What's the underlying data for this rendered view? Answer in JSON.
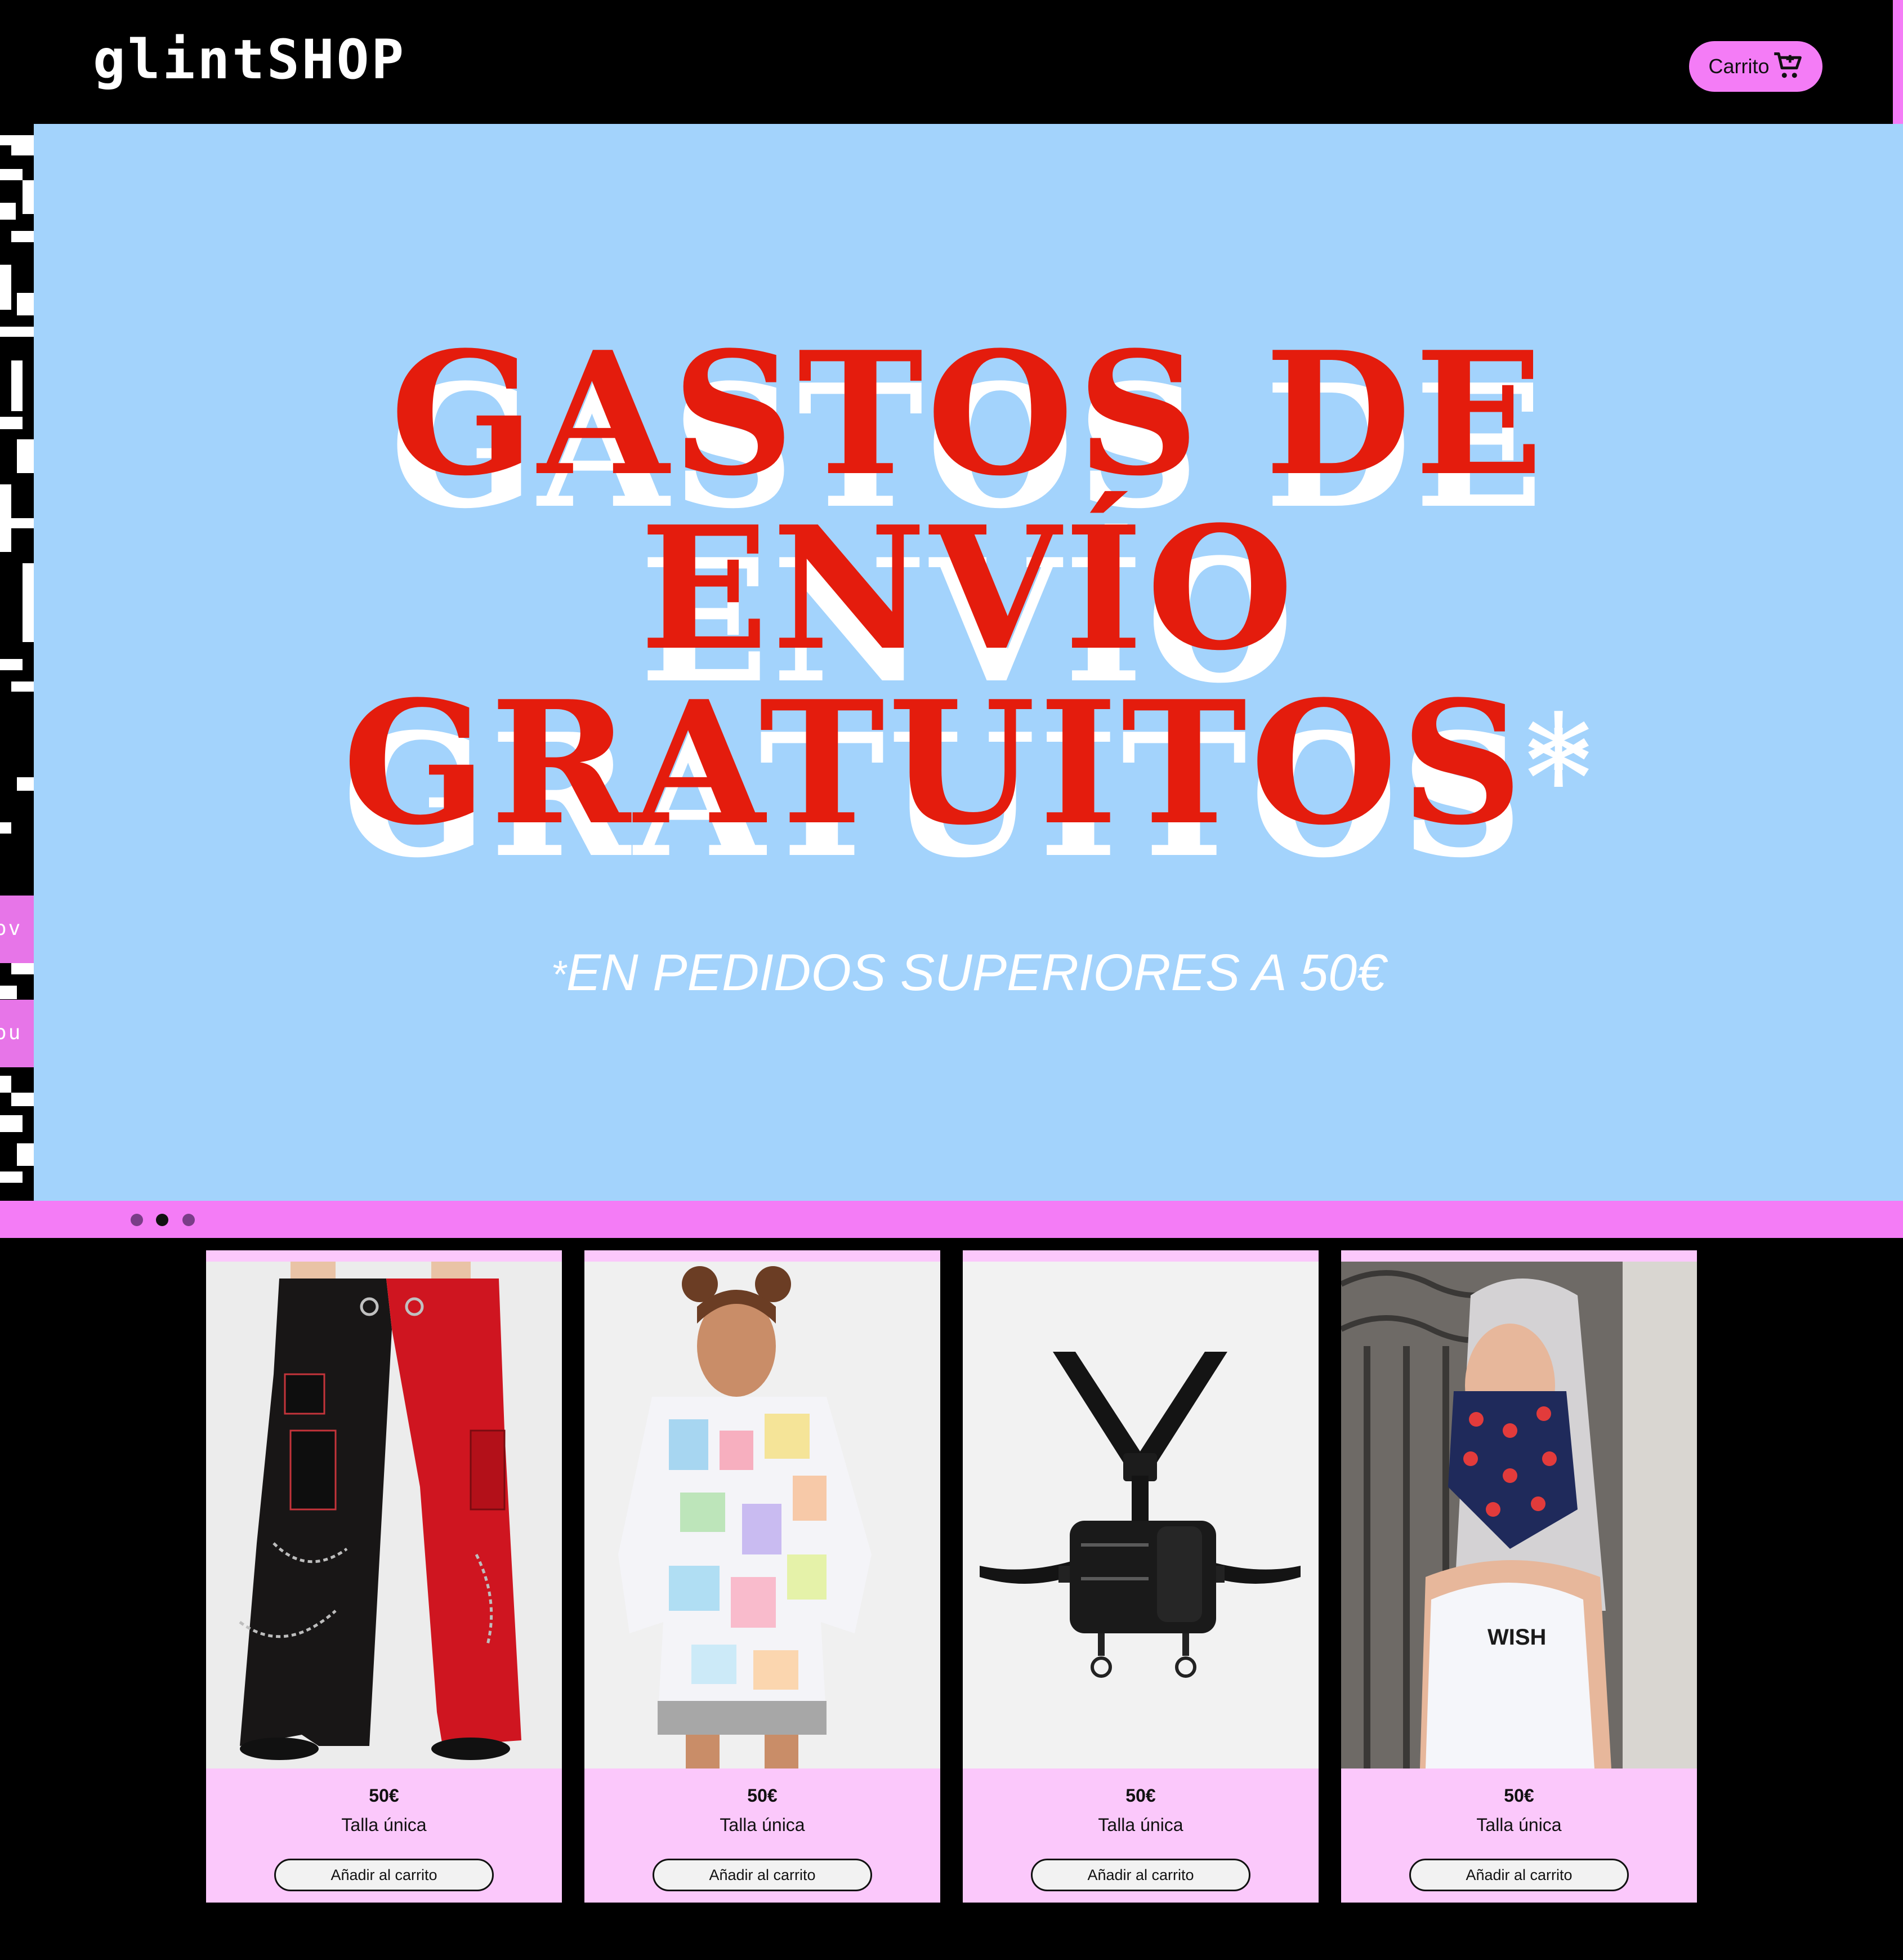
{
  "header": {
    "logo": "glintSHOP",
    "cart_label": "Carrito",
    "cart_icon": "shopping-cart-icon"
  },
  "side_tags": [
    "ov",
    "ou"
  ],
  "hero": {
    "title_lines": [
      "GASTOS DE",
      "ENVÍO",
      "GRATUITOS"
    ],
    "title_asterisk": "*",
    "subtitle_star": "*",
    "subtitle": "EN PEDIDOS SUPERIORES A 50€",
    "background_color": "#a3d3fc",
    "title_color": "#e41c0d"
  },
  "carousel": {
    "dots": 3,
    "active_dot": 1
  },
  "products": [
    {
      "price": "50€",
      "size": "Talla única",
      "button": "Añadir al carrito",
      "image": "red-black-cargo-pants"
    },
    {
      "price": "50€",
      "size": "Talla única",
      "button": "Añadir al carrito",
      "image": "printed-hoodie-dress"
    },
    {
      "price": "50€",
      "size": "Talla única",
      "button": "Añadir al carrito",
      "image": "black-harness-chest-bag"
    },
    {
      "price": "50€",
      "size": "Talla única",
      "button": "Añadir al carrito",
      "image": "cherry-print-face-mask"
    }
  ],
  "colors": {
    "accent_pink": "#f47cf6",
    "card_pink": "#fbc8fb",
    "page_black": "#000000"
  }
}
